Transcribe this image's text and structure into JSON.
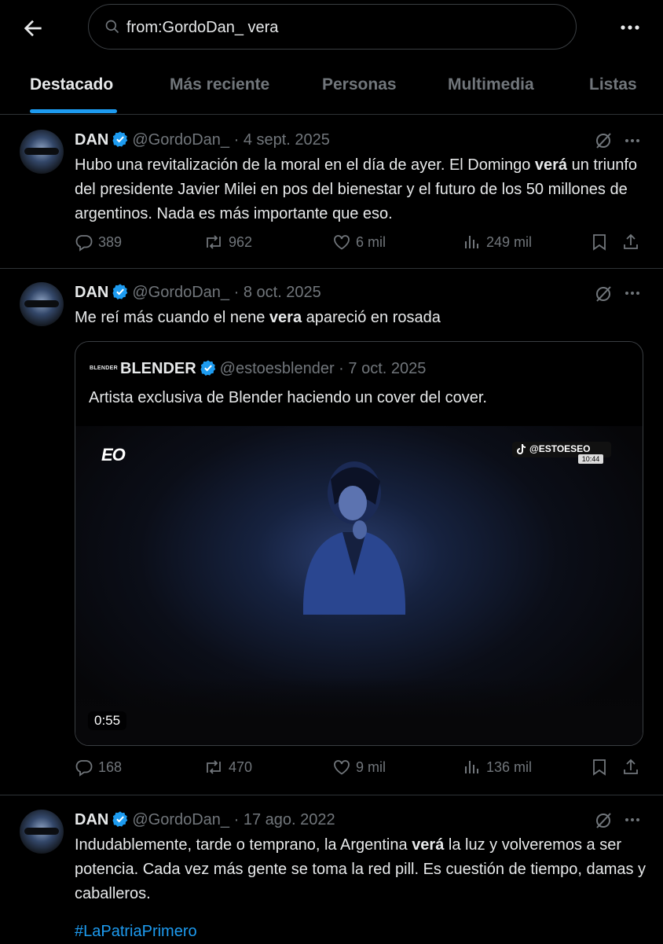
{
  "search": {
    "query": "from:GordoDan_ vera"
  },
  "tabs": [
    "Destacado",
    "Más reciente",
    "Personas",
    "Multimedia",
    "Listas"
  ],
  "tweets": [
    {
      "name": "DAN",
      "handle": "@GordoDan_",
      "date": "4 sept. 2025",
      "text_parts": [
        "Hubo una revitalización de la moral en el día de ayer. El Domingo ",
        "verá",
        " un triunfo del presidente Javier Milei en pos del bienestar y el futuro de los 50 millones de argentinos. Nada es más importante que eso."
      ],
      "replies": "389",
      "reposts": "962",
      "likes": "6 mil",
      "views": "249 mil"
    },
    {
      "name": "DAN",
      "handle": "@GordoDan_",
      "date": "8 oct. 2025",
      "text_parts": [
        "Me reí más cuando el nene ",
        "vera",
        " apareció en rosada"
      ],
      "quote": {
        "logo": "BLENDER",
        "name": "BLENDER",
        "handle": "@estoesblender",
        "date": "7 oct. 2025",
        "text": "Artista exclusiva de Blender haciendo un cover del cover.",
        "video_logo": "EO",
        "video_tag": "@ESTOESEO",
        "video_time": "10:44",
        "duration": "0:55"
      },
      "replies": "168",
      "reposts": "470",
      "likes": "9 mil",
      "views": "136 mil"
    },
    {
      "name": "DAN",
      "handle": "@GordoDan_",
      "date": "17 ago. 2022",
      "text_parts": [
        "Indudablemente, tarde o temprano, la Argentina ",
        "verá",
        " la luz y volveremos a ser potencia. Cada vez más gente se toma la red pill. Es cuestión de tiempo, damas y caballeros."
      ],
      "hashtag": "#LaPatriaPrimero"
    }
  ],
  "sep": " · ",
  "colors": {
    "accent": "#1d9bf0",
    "muted": "#71767b",
    "text": "#e7e9ea",
    "border": "#2f3336"
  },
  "icons": [
    "back-arrow-icon",
    "search-icon",
    "more-icon",
    "verified-icon",
    "grok-icon",
    "reply-icon",
    "repost-icon",
    "like-icon",
    "views-icon",
    "bookmark-icon",
    "share-icon"
  ]
}
